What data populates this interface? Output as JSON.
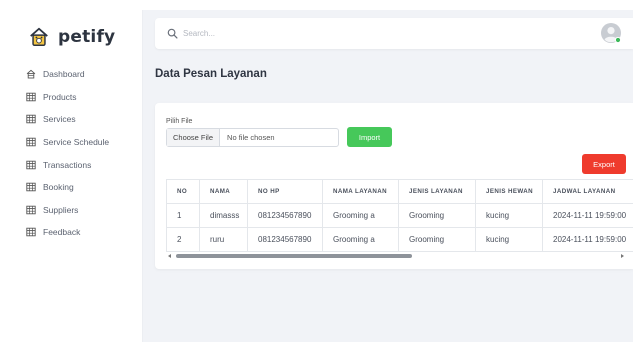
{
  "brand": {
    "name": "petify"
  },
  "sidebar": {
    "items": [
      {
        "label": "Dashboard",
        "icon": "home-icon"
      },
      {
        "label": "Products",
        "icon": "table-icon"
      },
      {
        "label": "Services",
        "icon": "table-icon"
      },
      {
        "label": "Service Schedule",
        "icon": "table-icon"
      },
      {
        "label": "Transactions",
        "icon": "table-icon"
      },
      {
        "label": "Booking",
        "icon": "table-icon"
      },
      {
        "label": "Suppliers",
        "icon": "table-icon"
      },
      {
        "label": "Feedback",
        "icon": "table-icon"
      }
    ]
  },
  "header": {
    "search": {
      "placeholder": "Search...",
      "value": ""
    }
  },
  "page": {
    "title": "Data Pesan Layanan"
  },
  "import_form": {
    "label": "Pilih File",
    "choose_label": "Choose File",
    "file_name": "No file chosen",
    "import_label": "Import"
  },
  "toolbar": {
    "export_label": "Export"
  },
  "table": {
    "columns": [
      "NO",
      "NAMA",
      "NO HP",
      "NAMA LAYANAN",
      "JENIS LAYANAN",
      "JENIS HEWAN",
      "JADWAL LAYANAN"
    ],
    "rows": [
      [
        "1",
        "dimasss",
        "081234567890",
        "Grooming a",
        "Grooming",
        "kucing",
        "2024-11-11 19:59:00"
      ],
      [
        "2",
        "ruru",
        "081234567890",
        "Grooming a",
        "Grooming",
        "kucing",
        "2024-11-11 19:59:00"
      ]
    ]
  },
  "colors": {
    "import": "#46c85a",
    "export": "#ef3b2d",
    "background": "#f1f3f7",
    "avatar_status": "#3cb95a"
  }
}
